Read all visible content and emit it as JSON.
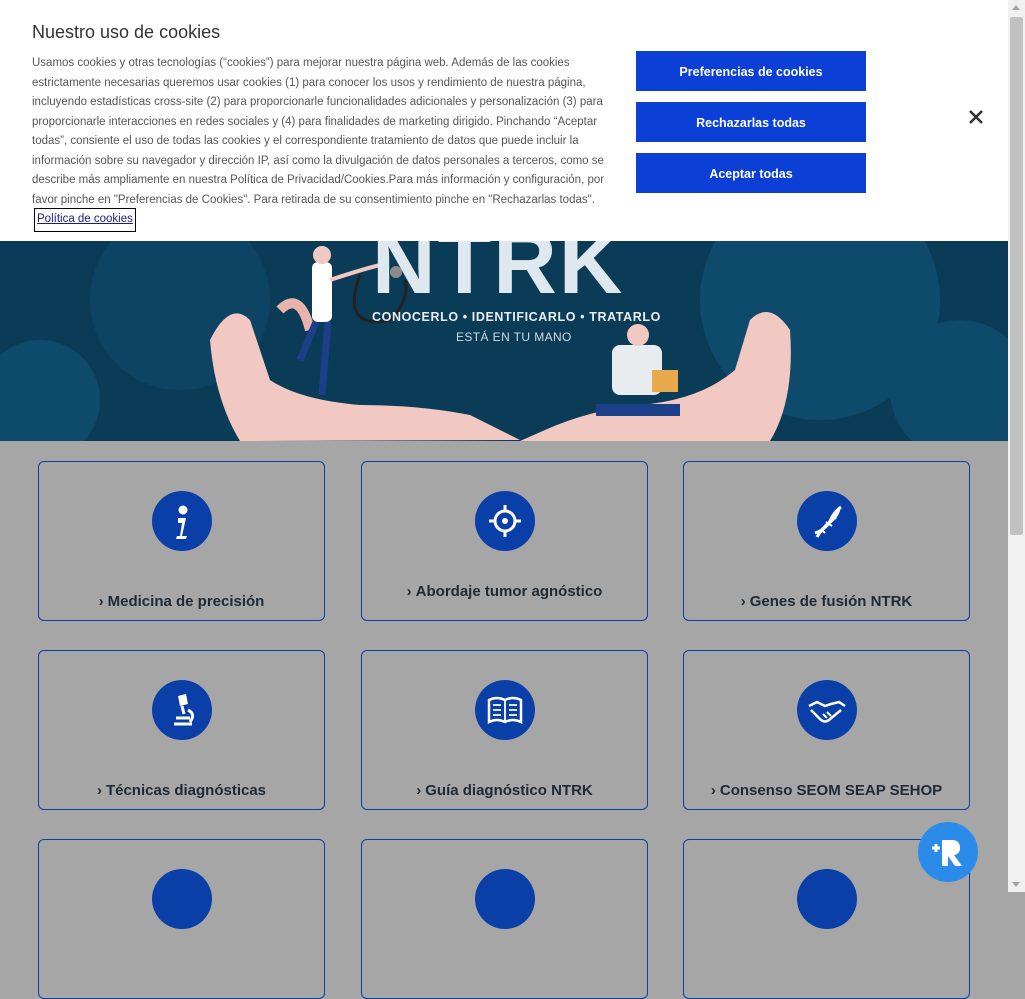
{
  "cookie_banner": {
    "title": "Nuestro uso de cookies",
    "text": "Usamos cookies y otras tecnologías (“cookies”) para mejorar nuestra página web. Además de las cookies estrictamente necesarias queremos usar cookies (1) para conocer los usos y rendimiento de nuestra página, incluyendo estadísticas cross-site (2) para proporcionarle funcionalidades adicionales y personalización (3) para proporcionarle interacciones en redes sociales y (4) para finalidades de marketing dirigido. Pinchando “Aceptar todas”, consiente el uso de todas las cookies y el correspondiente tratamiento de datos que puede incluir la información sobre su navegador y dirección IP, así como la divulgación de datos personales a terceros, como se describe más ampliamente en nuestra Política de Privacidad/Cookies.Para más información y configuración, por favor pinche en \"Preferencias de Cookies\". Para retirada de su consentimiento pinche en \"Rechazarlas todas\".",
    "policy_link": "Política de cookies",
    "btn_preferences": "Preferencias de cookies",
    "btn_reject": "Rechazarlas todas",
    "btn_accept": "Aceptar todas",
    "accent_color": "#0b3fd6"
  },
  "hero": {
    "title": "NTRK",
    "subtitle": "CONOCERLO • IDENTIFICARLO • TRATARLO",
    "tagline": "ESTÁ EN TU MANO"
  },
  "cards": [
    {
      "label": "Medicina de precisión",
      "icon": "info-icon"
    },
    {
      "label": "Abordaje tumor agnóstico",
      "icon": "crosshair-icon"
    },
    {
      "label": "Genes de fusión NTRK",
      "icon": "dna-icon"
    },
    {
      "label": "Técnicas diagnósticas",
      "icon": "microscope-icon"
    },
    {
      "label": "Guía diagnóstico NTRK",
      "icon": "book-icon"
    },
    {
      "label": "Consenso SEOM SEAP SEHOP",
      "icon": "handshake-icon"
    }
  ],
  "chevron": "›"
}
